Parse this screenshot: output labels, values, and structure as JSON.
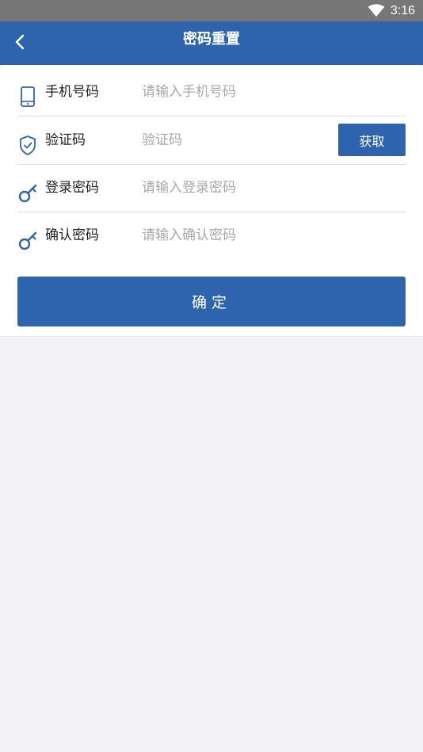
{
  "status_bar": {
    "time": "3:16",
    "wifi_icon": "wifi-icon"
  },
  "app_bar": {
    "title": "密码重置",
    "back_icon": "chevron-left-icon"
  },
  "colors": {
    "primary": "#2e64ae",
    "status_bar": "#777777",
    "background": "#f2f2f7",
    "placeholder": "#a8a8a8"
  },
  "form": {
    "phone": {
      "label": "手机号码",
      "placeholder": "请输入手机号码",
      "value": "",
      "icon": "phone-icon"
    },
    "code": {
      "label": "验证码",
      "placeholder": "验证码",
      "value": "",
      "icon": "shield-check-icon",
      "get_button": "获取"
    },
    "login_password": {
      "label": "登录密码",
      "placeholder": "请输入登录密码",
      "value": "",
      "icon": "key-icon"
    },
    "confirm_password": {
      "label": "确认密码",
      "placeholder": "请输入确认密码",
      "value": "",
      "icon": "key-icon"
    },
    "submit": "确定"
  }
}
